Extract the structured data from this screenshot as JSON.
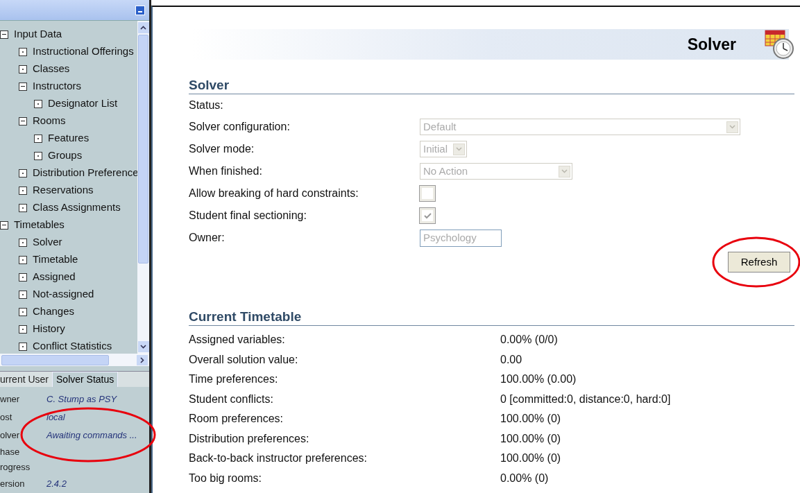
{
  "sidebar": {
    "tree": [
      {
        "label": "Input Data",
        "expanded": true,
        "children": [
          {
            "label": "Instructional Offerings"
          },
          {
            "label": "Classes"
          },
          {
            "label": "Instructors",
            "expanded": true,
            "children": [
              {
                "label": "Designator List"
              }
            ]
          },
          {
            "label": "Rooms",
            "expanded": true,
            "children": [
              {
                "label": "Features"
              },
              {
                "label": "Groups"
              }
            ]
          },
          {
            "label": "Distribution Preference"
          },
          {
            "label": "Reservations"
          },
          {
            "label": "Class Assignments"
          }
        ]
      },
      {
        "label": "Timetables",
        "expanded": true,
        "children": [
          {
            "label": "Solver"
          },
          {
            "label": "Timetable"
          },
          {
            "label": "Assigned"
          },
          {
            "label": "Not-assigned"
          },
          {
            "label": "Changes"
          },
          {
            "label": "History"
          },
          {
            "label": "Conflict Statistics"
          }
        ]
      }
    ],
    "tabs": [
      {
        "label": "urrent User",
        "selected": false
      },
      {
        "label": "Solver Status",
        "selected": true
      }
    ],
    "status": [
      {
        "label": "wner",
        "value": "C. Stump as PSY"
      },
      {
        "label": "ost",
        "value": "local"
      },
      {
        "label": "olver",
        "value": "Awaiting commands ..."
      },
      {
        "label": "hase"
      },
      {
        "label": "rogress"
      },
      {
        "label": "ersion",
        "value": "2.4.2"
      }
    ]
  },
  "header": {
    "title": "Solver"
  },
  "solver": {
    "heading": "Solver",
    "fields": [
      {
        "kind": "text",
        "label": "Status:"
      },
      {
        "kind": "select",
        "label": "Solver configuration:",
        "value": "Default",
        "disabled": true
      },
      {
        "kind": "select",
        "label": "Solver mode:",
        "value": "Initial",
        "disabled": true
      },
      {
        "kind": "select",
        "label": "When finished:",
        "value": "No Action",
        "disabled": true
      },
      {
        "kind": "checkbox",
        "label": "Allow breaking of hard constraints:",
        "checked": false,
        "disabled": true
      },
      {
        "kind": "checkbox",
        "label": "Student final sectioning:",
        "checked": true,
        "disabled": true
      },
      {
        "kind": "input",
        "label": "Owner:",
        "value": "Psychology",
        "disabled": true
      }
    ],
    "button": "Refresh"
  },
  "timetable": {
    "heading": "Current Timetable",
    "rows": [
      {
        "label": "Assigned variables:",
        "value": "0.00% (0/0)"
      },
      {
        "label": "Overall solution value:",
        "value": "0.00"
      },
      {
        "label": "Time preferences:",
        "value": "100.00% (0.00)"
      },
      {
        "label": "Student conflicts:",
        "value": "0 [committed:0, distance:0, hard:0]"
      },
      {
        "label": "Room preferences:",
        "value": "100.00% (0)"
      },
      {
        "label": "Distribution preferences:",
        "value": "100.00% (0)"
      },
      {
        "label": "Back-to-back instructor preferences:",
        "value": "100.00% (0)"
      },
      {
        "label": "Too big rooms:",
        "value": "0.00% (0)"
      }
    ]
  }
}
